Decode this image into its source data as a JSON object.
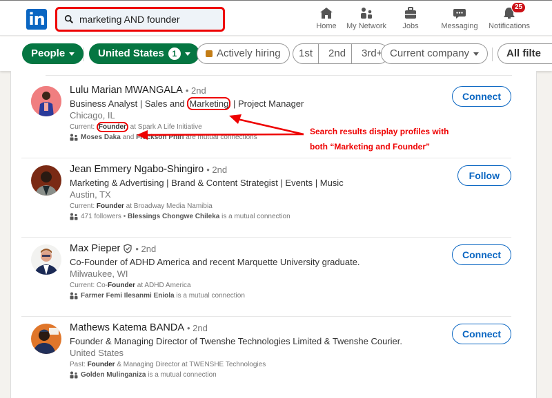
{
  "topbar": {
    "logo": "in",
    "search_value": "marketing AND founder",
    "nav": [
      {
        "label": "Home",
        "icon": "home-icon"
      },
      {
        "label": "My Network",
        "icon": "network-icon"
      },
      {
        "label": "Jobs",
        "icon": "briefcase-icon"
      },
      {
        "label": "Messaging",
        "icon": "message-icon"
      },
      {
        "label": "Notifications",
        "icon": "bell-icon",
        "badge": "25"
      }
    ]
  },
  "filters": {
    "people": "People",
    "location": "United States",
    "location_count": "1",
    "actively_hiring": "Actively hiring",
    "degrees": [
      "1st",
      "2nd",
      "3rd+"
    ],
    "current_company": "Current company",
    "all_filters": "All filte"
  },
  "results": [
    {
      "name": "Lulu Marian MWANGALA",
      "degree": "• 2nd",
      "headline_pre": "Business Analyst | Sales and ",
      "headline_hl": "Marketing",
      "headline_post": " | Project Manager",
      "location": "Chicago, IL",
      "current_label": "Current: ",
      "current_bold": "Founder",
      "current_rest": " at Spark A Life Initiative",
      "mutual_a": "Moses Daka",
      "mutual_mid": " and ",
      "mutual_b": "Frackson Phiri",
      "mutual_rest": " are mutual connections",
      "action": "Connect"
    },
    {
      "name": "Jean Emmery Ngabo-Shingiro",
      "degree": "• 2nd",
      "headline": "Marketing & Advertising | Brand & Content Strategist | Events | Music",
      "location": "Austin, TX",
      "current_label": "Current: ",
      "current_bold": "Founder",
      "current_rest": " at Broadway Media Namibia",
      "mutual_pre": "471 followers • ",
      "mutual_a": "Blessings Chongwe Chileka",
      "mutual_rest": " is a mutual connection",
      "action": "Follow"
    },
    {
      "name": "Max Pieper",
      "degree": "• 2nd",
      "headline": "Co-Founder of ADHD America and recent Marquette University graduate.",
      "location": "Milwaukee, WI",
      "current_label": "Current: Co-",
      "current_bold": "Founder",
      "current_rest": " at ADHD America",
      "mutual_a": "Farmer Femi Ilesanmi Eniola",
      "mutual_rest": " is a mutual connection",
      "action": "Connect"
    },
    {
      "name": "Mathews Katema BANDA",
      "degree": "• 2nd",
      "headline": "Founder & Managing Director of Twenshe Technologies Limited & Twenshe Courier.",
      "location": "United States",
      "current_label": "Past: ",
      "current_bold": "Founder",
      "current_rest": " & Managing Director at TWENSHE Technologies",
      "mutual_a": "Golden Mulinganiza",
      "mutual_rest": " is a mutual connection",
      "action": "Connect"
    }
  ],
  "annotation": {
    "line1": "Search results display profiles with",
    "line2": "both “Marketing and Founder”",
    "color": "#ee0000"
  }
}
